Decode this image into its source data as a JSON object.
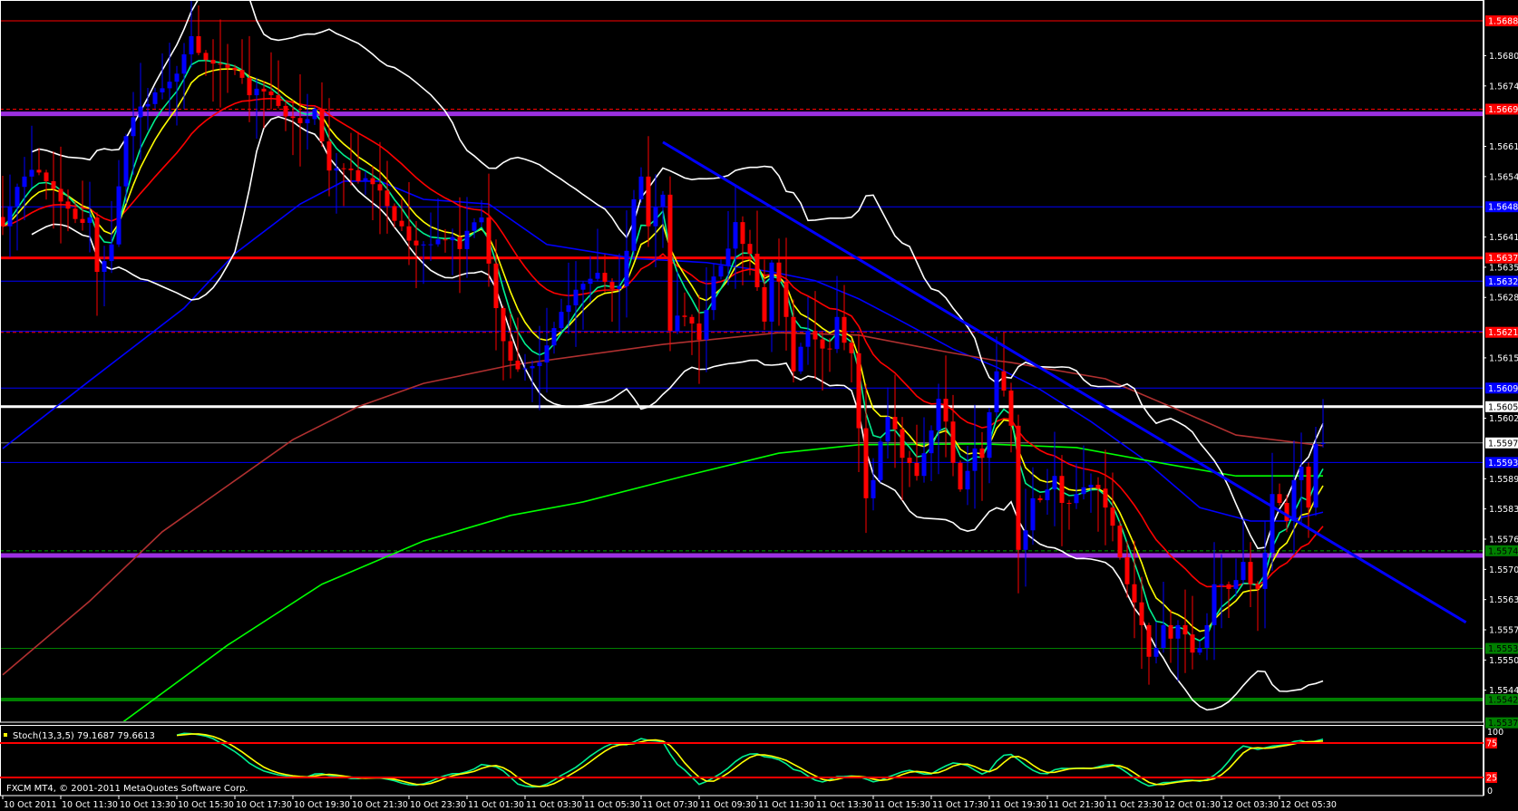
{
  "chart_data": {
    "type": "candlestick",
    "ylim": [
      1.55371,
      1.56925
    ],
    "colors": {
      "bull": "#0000ff",
      "bear": "#ff0000",
      "background": "#000000",
      "frame": "#ffffff"
    },
    "closes": [
      [
        0,
        1.56438
      ],
      [
        3,
        1.56545
      ],
      [
        6,
        1.56535
      ],
      [
        9,
        1.56476
      ],
      [
        12,
        1.56457
      ],
      [
        13,
        1.5634
      ],
      [
        15,
        1.56399
      ],
      [
        17,
        1.56632
      ],
      [
        20,
        1.56701
      ],
      [
        23,
        1.56749
      ],
      [
        25,
        1.56808
      ],
      [
        26,
        1.56847
      ],
      [
        29,
        1.56788
      ],
      [
        31,
        1.56779
      ],
      [
        34,
        1.5672
      ],
      [
        37,
        1.5672
      ],
      [
        40,
        1.56671
      ],
      [
        43,
        1.56691
      ],
      [
        45,
        1.56558
      ],
      [
        49,
        1.56535
      ],
      [
        52,
        1.56515
      ],
      [
        55,
        1.56438
      ],
      [
        58,
        1.56399
      ],
      [
        61,
        1.56408
      ],
      [
        63,
        1.56389
      ],
      [
        66,
        1.56457
      ],
      [
        68,
        1.56262
      ],
      [
        70,
        1.56149
      ],
      [
        74,
        1.56145
      ],
      [
        78,
        1.56268
      ],
      [
        82,
        1.56338
      ],
      [
        85,
        1.56309
      ],
      [
        87,
        1.56496
      ],
      [
        88,
        1.56545
      ],
      [
        89,
        1.56438
      ],
      [
        91,
        1.56506
      ],
      [
        92,
        1.56213
      ],
      [
        94,
        1.56243
      ],
      [
        96,
        1.56194
      ],
      [
        98,
        1.5633
      ],
      [
        101,
        1.56447
      ],
      [
        103,
        1.56379
      ],
      [
        105,
        1.56233
      ],
      [
        106,
        1.5636
      ],
      [
        108,
        1.56243
      ],
      [
        109,
        1.56126
      ],
      [
        111,
        1.56213
      ],
      [
        114,
        1.56174
      ],
      [
        115,
        1.56243
      ],
      [
        117,
        1.56165
      ],
      [
        119,
        1.55853
      ],
      [
        120,
        1.55892
      ],
      [
        122,
        1.56028
      ],
      [
        124,
        1.5594
      ],
      [
        126,
        1.55901
      ],
      [
        129,
        1.56067
      ],
      [
        130,
        1.56018
      ],
      [
        132,
        1.55872
      ],
      [
        134,
        1.5596
      ],
      [
        135,
        1.5594
      ],
      [
        136,
        1.56038
      ],
      [
        137,
        1.56126
      ],
      [
        139,
        1.56009
      ],
      [
        140,
        1.55742
      ],
      [
        141,
        1.55784
      ],
      [
        142,
        1.55853
      ],
      [
        144,
        1.55872
      ],
      [
        145,
        1.55901
      ],
      [
        146,
        1.55843
      ],
      [
        148,
        1.55862
      ],
      [
        150,
        1.55882
      ],
      [
        152,
        1.55833
      ],
      [
        153,
        1.55794
      ],
      [
        154,
        1.55726
      ],
      [
        155,
        1.55668
      ],
      [
        156,
        1.55629
      ],
      [
        157,
        1.5558
      ],
      [
        158,
        1.55512
      ],
      [
        159,
        1.55531
      ],
      [
        160,
        1.5558
      ],
      [
        161,
        1.55551
      ],
      [
        162,
        1.5558
      ],
      [
        163,
        1.5556
      ],
      [
        164,
        1.55521
      ],
      [
        165,
        1.55531
      ],
      [
        166,
        1.5558
      ],
      [
        167,
        1.55668
      ],
      [
        168,
        1.55668
      ],
      [
        169,
        1.55658
      ],
      [
        170,
        1.55677
      ],
      [
        171,
        1.55716
      ],
      [
        172,
        1.55668
      ],
      [
        173,
        1.55658
      ],
      [
        174,
        1.55736
      ],
      [
        175,
        1.55862
      ],
      [
        176,
        1.55843
      ],
      [
        177,
        1.55804
      ],
      [
        178,
        1.55892
      ],
      [
        179,
        1.55921
      ],
      [
        180,
        1.55833
      ],
      [
        181,
        1.5597
      ],
      [
        182,
        1.55972
      ]
    ],
    "moving_averages": [
      {
        "name": "ma-blue",
        "color": "#0000ff",
        "points": [
          [
            0,
            1.5596
          ],
          [
            12,
            1.56106
          ],
          [
            25,
            1.56262
          ],
          [
            32,
            1.56379
          ],
          [
            41,
            1.56486
          ],
          [
            47,
            1.56535
          ],
          [
            52,
            1.56535
          ],
          [
            58,
            1.56496
          ],
          [
            67,
            1.56486
          ],
          [
            75,
            1.56399
          ],
          [
            87,
            1.56369
          ],
          [
            97,
            1.5636
          ],
          [
            106,
            1.5634
          ],
          [
            112,
            1.56321
          ],
          [
            118,
            1.56282
          ],
          [
            124,
            1.56233
          ],
          [
            131,
            1.56174
          ],
          [
            137,
            1.56135
          ],
          [
            143,
            1.56087
          ],
          [
            150,
            1.56018
          ],
          [
            157,
            1.5594
          ],
          [
            165,
            1.55833
          ],
          [
            172,
            1.55804
          ],
          [
            177,
            1.55804
          ],
          [
            182,
            1.55823
          ]
        ]
      },
      {
        "name": "ma-brown",
        "color": "#b03030",
        "points": [
          [
            0,
            1.55473
          ],
          [
            12,
            1.55632
          ],
          [
            22,
            1.55781
          ],
          [
            31,
            1.5588
          ],
          [
            40,
            1.55979
          ],
          [
            49,
            1.5605
          ],
          [
            58,
            1.561
          ],
          [
            70,
            1.56139
          ],
          [
            91,
            1.56184
          ],
          [
            107,
            1.56209
          ],
          [
            118,
            1.56204
          ],
          [
            130,
            1.56168
          ],
          [
            137,
            1.56149
          ],
          [
            139,
            1.56145
          ],
          [
            152,
            1.5611
          ],
          [
            161,
            1.5605
          ],
          [
            170,
            1.55989
          ],
          [
            182,
            1.55966
          ]
        ]
      },
      {
        "name": "ma-lime",
        "color": "#00ff00",
        "points": [
          [
            16,
            1.55365
          ],
          [
            31,
            1.55537
          ],
          [
            44,
            1.55668
          ],
          [
            58,
            1.55761
          ],
          [
            70,
            1.55816
          ],
          [
            80,
            1.55845
          ],
          [
            94,
            1.55901
          ],
          [
            107,
            1.5595
          ],
          [
            118,
            1.55968
          ],
          [
            135,
            1.5597
          ],
          [
            148,
            1.55962
          ],
          [
            161,
            1.55925
          ],
          [
            170,
            1.55901
          ],
          [
            182,
            1.55901
          ]
        ]
      }
    ],
    "computed_indicators": [
      {
        "name": "ema-5",
        "period": 5,
        "color": "#00f090"
      },
      {
        "name": "ema-8",
        "period": 8,
        "color": "#ffff00"
      },
      {
        "name": "ema-21",
        "period": 21,
        "color": "#ff0000"
      },
      {
        "name": "bollinger-bands",
        "period": 20,
        "deviation": 2,
        "color": "#ffffff"
      }
    ],
    "trendline": {
      "color": "#0000ff",
      "from": [
        91,
        1.56619
      ],
      "to": [
        201.7,
        1.55586
      ]
    },
    "levels": [
      {
        "price": 1.5688,
        "color": "#ff0000",
        "width": 1,
        "dashed": false,
        "label": "1.56880",
        "label_bg": "#ff0000",
        "label_fg": "#ffffff"
      },
      {
        "price": 1.5669,
        "color": "#ff0000",
        "width": 1,
        "dashed": true,
        "label": "1.56690",
        "label_bg": "#ff0000",
        "label_fg": "#ffffff"
      },
      {
        "price": 1.5668,
        "color": "#9b30e0",
        "width": 5,
        "dashed": false
      },
      {
        "price": 1.5648,
        "color": "#0000ff",
        "width": 1,
        "dashed": false,
        "label": "1.56480",
        "label_bg": "#0000ff",
        "label_fg": "#ffffff"
      },
      {
        "price": 1.5637,
        "color": "#ff0000",
        "width": 3,
        "dashed": false,
        "label": "1.56370",
        "label_bg": "#ff0000",
        "label_fg": "#ffffff"
      },
      {
        "price": 1.5632,
        "color": "#0000ff",
        "width": 1,
        "dashed": false,
        "label": "1.56320",
        "label_bg": "#0000ff",
        "label_fg": "#ffffff"
      },
      {
        "price": 1.56212,
        "color": "#0000ff",
        "width": 1,
        "dashed": false
      },
      {
        "price": 1.5621,
        "color": "#ff0000",
        "width": 1,
        "dashed": true,
        "label": "1.56210",
        "label_bg": "#ff0000",
        "label_fg": "#ffffff"
      },
      {
        "price": 1.5609,
        "color": "#0000ff",
        "width": 1,
        "dashed": false,
        "label": "1.56090",
        "label_bg": "#0000ff",
        "label_fg": "#ffffff"
      },
      {
        "price": 1.5605,
        "color": "#ffffff",
        "width": 3,
        "dashed": false,
        "label": "1.56050",
        "label_bg": "#ffffff",
        "label_fg": "#000000"
      },
      {
        "price": 1.55972,
        "color": "#909090",
        "width": 1,
        "dashed": false,
        "label": "1.55972",
        "label_bg": "#ffffff",
        "label_fg": "#000000"
      },
      {
        "price": 1.5593,
        "color": "#0000ff",
        "width": 1,
        "dashed": false,
        "label": "1.55930",
        "label_bg": "#0000ff",
        "label_fg": "#ffffff"
      },
      {
        "price": 1.5574,
        "color": "#00a000",
        "width": 1,
        "dashed": true,
        "label": "1.55740",
        "label_bg": "#008000",
        "label_fg": "#000000"
      },
      {
        "price": 1.5573,
        "color": "#9b30e0",
        "width": 5,
        "dashed": false
      },
      {
        "price": 1.5553,
        "color": "#008000",
        "width": 1,
        "dashed": false,
        "label": "1.55530",
        "label_bg": "#008000",
        "label_fg": "#000000"
      },
      {
        "price": 1.5542,
        "color": "#008000",
        "width": 4,
        "dashed": false,
        "label": "1.55420",
        "label_bg": "#008000",
        "label_fg": "#000000"
      },
      {
        "price": 1.5537,
        "color": "#008000",
        "width": 1,
        "dashed": false,
        "label": "1.55370",
        "label_bg": "#008000",
        "label_fg": "#000000"
      }
    ],
    "price_ticks": [
      "1.56805",
      "1.56740",
      "1.56610",
      "1.56545",
      "1.56415",
      "1.56350",
      "1.56285",
      "1.56155",
      "1.56025",
      "1.55895",
      "1.55830",
      "1.55765",
      "1.55700",
      "1.55635",
      "1.55570",
      "1.55505",
      "1.55440"
    ],
    "time_labels": [
      "10 Oct 2011",
      "10 Oct 11:30",
      "10 Oct 13:30",
      "10 Oct 15:30",
      "10 Oct 17:30",
      "10 Oct 19:30",
      "10 Oct 21:30",
      "10 Oct 23:30",
      "11 Oct 01:30",
      "11 Oct 03:30",
      "11 Oct 05:30",
      "11 Oct 07:30",
      "11 Oct 09:30",
      "11 Oct 11:30",
      "11 Oct 13:30",
      "11 Oct 15:30",
      "11 Oct 17:30",
      "11 Oct 19:30",
      "11 Oct 21:30",
      "11 Oct 23:30",
      "12 Oct 01:30",
      "12 Oct 03:30",
      "12 Oct 05:30"
    ],
    "stochastic": {
      "label": "Stoch(13,3,5) 79.1687 79.6613",
      "k_period": 13,
      "d_period": 3,
      "slowing": 5,
      "k_value": 79.1687,
      "d_value": 79.6613,
      "k_color": "#00f090",
      "d_color": "#ffff00",
      "levels": [
        {
          "value": 75,
          "label": "75"
        },
        {
          "value": 25,
          "label": "25"
        }
      ],
      "scale_labels": [
        {
          "value": 100,
          "label": "100"
        },
        {
          "value": 0,
          "label": "0"
        }
      ],
      "ylim": [
        0,
        100
      ]
    }
  },
  "footer": {
    "copyright": "FXCM MT4, © 2001-2011 MetaQuotes Software Corp."
  }
}
